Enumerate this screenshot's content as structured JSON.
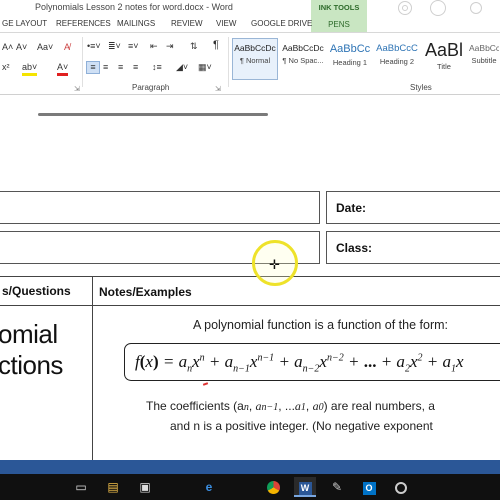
{
  "window": {
    "title": "Polynomials Lesson 2 notes for word.docx - Word"
  },
  "contextual_tab": {
    "group": "INK TOOLS",
    "tab": "PENS"
  },
  "ribbon_tabs": [
    "GE LAYOUT",
    "REFERENCES",
    "MAILINGS",
    "REVIEW",
    "VIEW",
    "GOOGLE DRIVE"
  ],
  "font_group": {
    "grow": "A˄",
    "shrink": "A˅",
    "change_case": "Aa˅",
    "clear": "A̸",
    "superscript": "x²",
    "highlight": "ab˅",
    "font_color": "A˅"
  },
  "paragraph_group": {
    "label": "Paragraph",
    "show_marks": "¶"
  },
  "styles_group": {
    "label": "Styles",
    "items": [
      {
        "preview": "AaBbCcDc",
        "name": "¶ Normal",
        "selected": true
      },
      {
        "preview": "AaBbCcDc",
        "name": "¶ No Spac..."
      },
      {
        "preview": "AaBbCc",
        "name": "Heading 1"
      },
      {
        "preview": "AaBbCcC",
        "name": "Heading 2"
      },
      {
        "preview": "AaBl",
        "name": "Title"
      },
      {
        "preview": "AaBbCcD",
        "name": "Subtitle"
      }
    ]
  },
  "document": {
    "date_label": "Date:",
    "class_label": "Class:",
    "col1_header": "s/Questions",
    "col2_header": "Notes/Examples",
    "topic_line1": "omial",
    "topic_line2": "ctions",
    "intro": "A polynomial function is a function of the form:",
    "coef_line": "The coefficients (a",
    "coef_line_rest": ") are real numbers, a",
    "n_line": "and n is a positive integer.   (No negative exponent"
  },
  "taskbar": {
    "items": [
      "task-view",
      "file-explorer",
      "store",
      "edge",
      "chrome",
      "word",
      "paint",
      "outlook",
      "cortana"
    ]
  }
}
